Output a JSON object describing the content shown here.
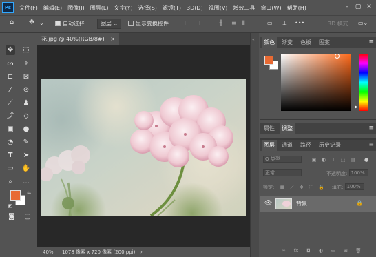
{
  "app": {
    "logo": "Ps"
  },
  "menu": {
    "items": [
      "文件(F)",
      "编辑(E)",
      "图像(I)",
      "图层(L)",
      "文字(Y)",
      "选择(S)",
      "滤镜(T)",
      "3D(D)",
      "视图(V)",
      "增效工具",
      "窗口(W)",
      "帮助(H)"
    ]
  },
  "options": {
    "auto_select_label": "自动选择:",
    "auto_select_value": "图层",
    "show_transform_label": "显示变换控件",
    "more": "•••",
    "mode_3d": "3D 模式:"
  },
  "document": {
    "tab_title": "花.jpg @ 40%(RGB/8#)",
    "tab_close": "×",
    "zoom": "40%",
    "info": "1078 像素 x 720 像素 (200 ppi)"
  },
  "colors": {
    "foreground": "#e86a33",
    "background": "#ffffff",
    "picker_hue": "#ff6a1a"
  },
  "panels": {
    "color_tabs": [
      "颜色",
      "渐变",
      "色板",
      "图案"
    ],
    "properties_tabs": [
      "属性",
      "调整"
    ],
    "layers_tabs": [
      "图层",
      "通道",
      "路径",
      "历史记录"
    ],
    "layers": {
      "filter_kind": "Q 类型",
      "blend_mode": "正常",
      "opacity_label": "不透明度:",
      "opacity_value": "100%",
      "lock_label": "锁定:",
      "fill_label": "填充:",
      "fill_value": "100%",
      "items": [
        {
          "name": "背景",
          "visible": true,
          "locked": true
        }
      ]
    }
  }
}
